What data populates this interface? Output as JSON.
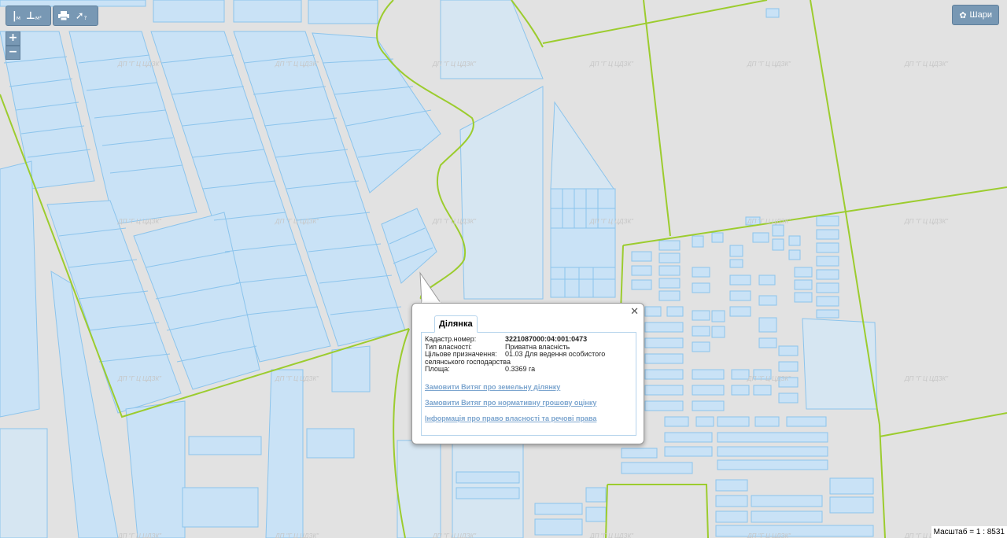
{
  "toolbar": {
    "measure_distance_icon": "ruler-line-icon",
    "measure_distance_sub": "м",
    "measure_area_icon": "ruler-area-icon",
    "measure_area_sub": "м²",
    "print_icon": "printer-icon",
    "identify_icon": "pointer-question-icon",
    "identify_label": "?"
  },
  "zoom": {
    "in_label": "+",
    "out_label": "−"
  },
  "layers_button": {
    "label": "Шари",
    "icon": "gear-icon"
  },
  "watermark": "ДП \"Г Ц ЦДЗК\"",
  "popup": {
    "close_label": "✕",
    "tab_label": "Ділянка",
    "fields": [
      {
        "key": "Кадастр.номер:",
        "value": "3221087000:04:001:0473"
      },
      {
        "key": "Тип власності:",
        "value": "Приватна власність"
      },
      {
        "key": "Цільове призначення:",
        "value": "01.03 Для ведення особистого"
      },
      {
        "key": "селянського господарства",
        "value": ""
      },
      {
        "key": "Площа:",
        "value": "0.3369 га"
      }
    ],
    "links": [
      "Замовити Витяг про земельну ділянку",
      "Замовити Витяг про нормативну грошову оцінку",
      "Інформація про право власності та речові права"
    ]
  },
  "scale_label": "Масштаб = 1 : 8531",
  "colors": {
    "parcel_fill": "#c9e2f6",
    "parcel_stroke": "#8cc4ec",
    "boundary": "#9ccc2e",
    "background": "#e2e2e2",
    "control": "#7898b4"
  }
}
